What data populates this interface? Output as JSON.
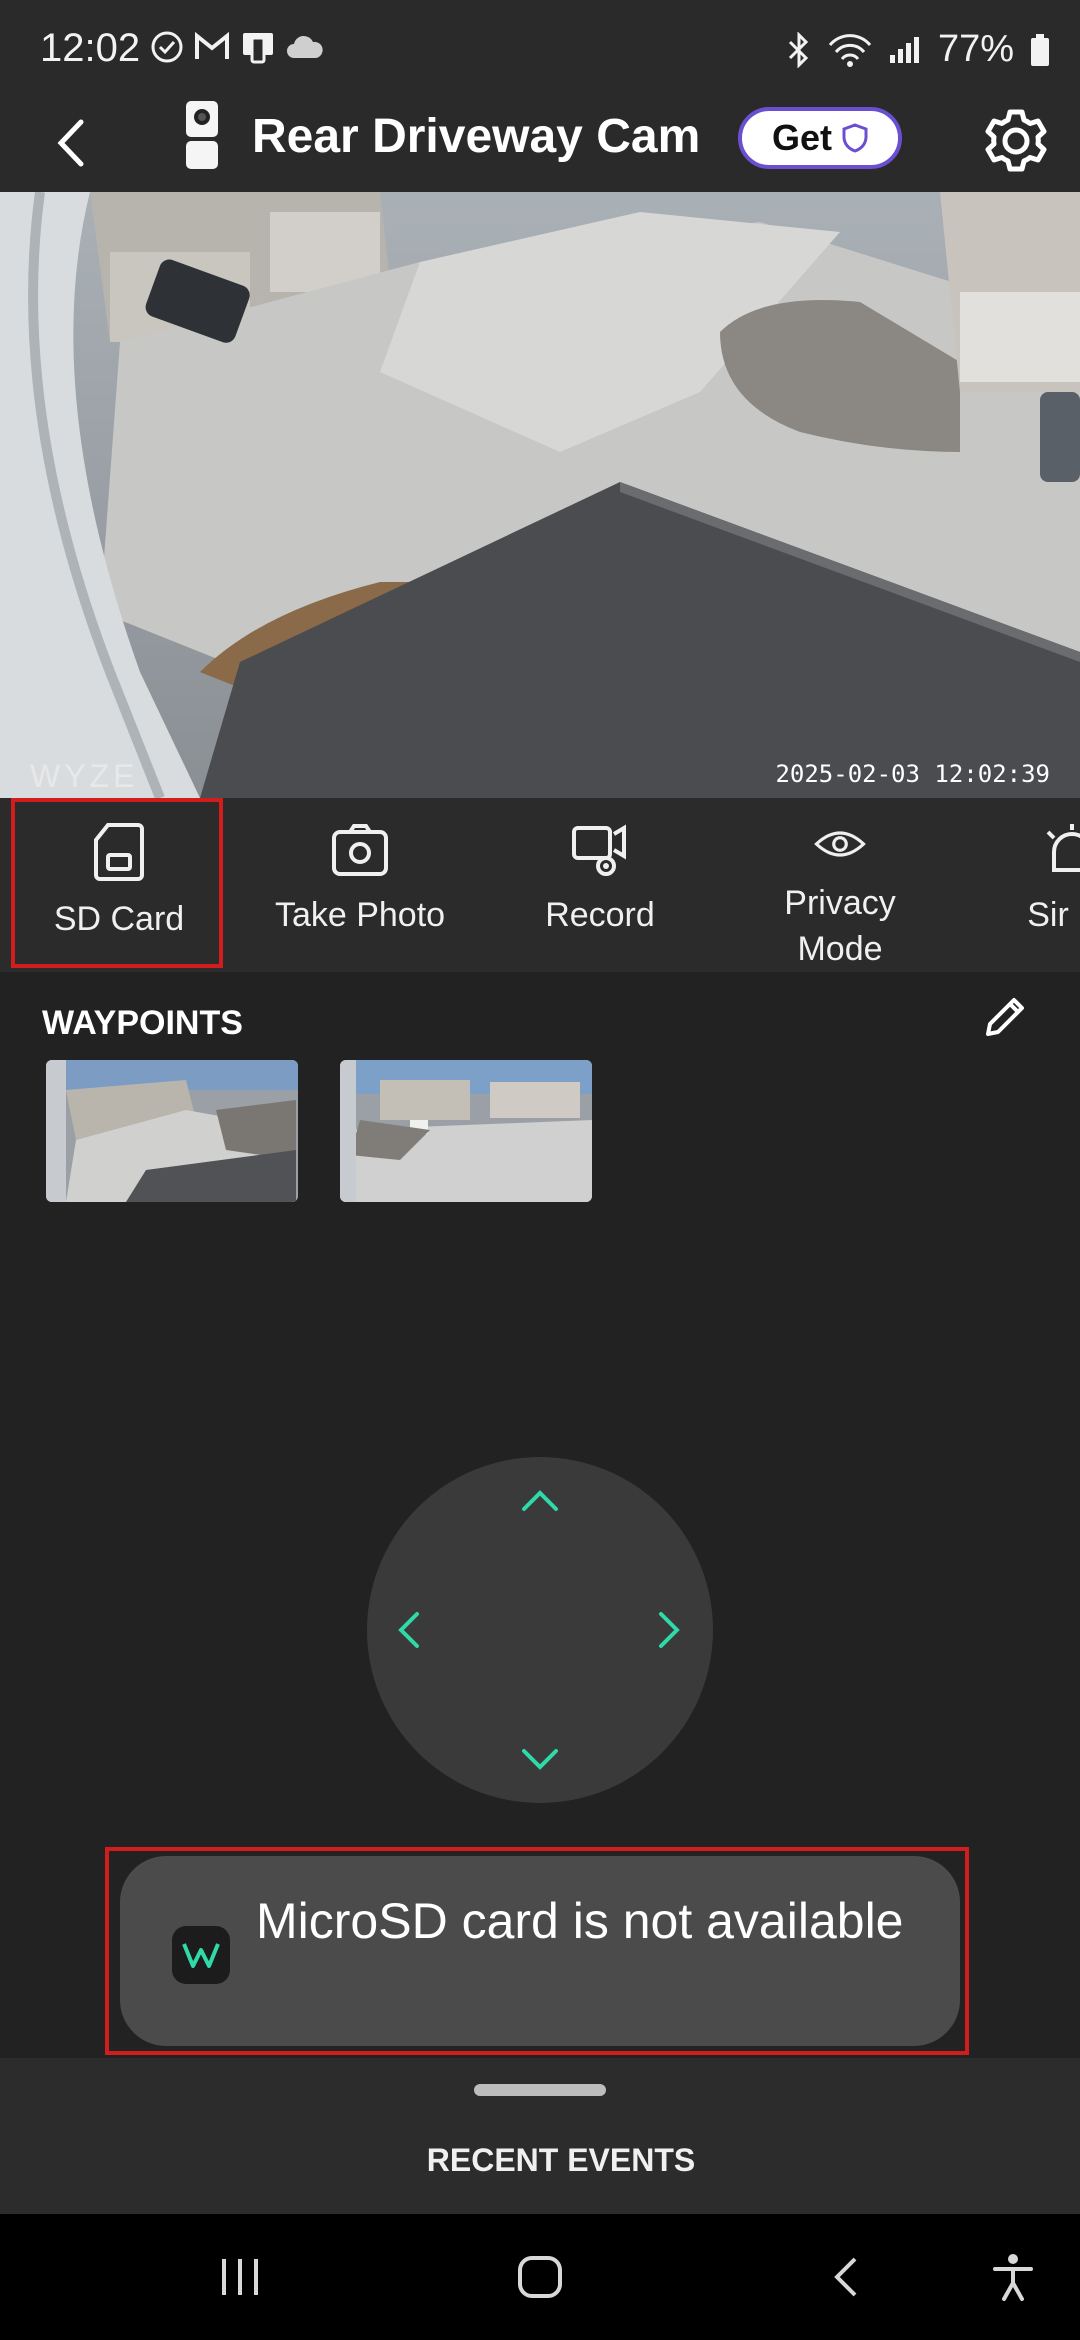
{
  "status_bar": {
    "time": "12:02",
    "battery": "77%"
  },
  "header": {
    "title": "Rear Driveway Cam",
    "get_label": "Get"
  },
  "video": {
    "watermark": "WYZE",
    "timestamp": "2025-02-03 12:02:39"
  },
  "controls": [
    {
      "label": "SD Card"
    },
    {
      "label": "Take Photo"
    },
    {
      "label": "Record"
    },
    {
      "label": "Privacy Mode"
    },
    {
      "label": "Sir"
    }
  ],
  "waypoints": {
    "title": "WAYPOINTS"
  },
  "toast": {
    "message": "MicroSD card is not available"
  },
  "recent_events": {
    "label": "RECENT EVENTS"
  },
  "colors": {
    "accent": "#2fd9a8",
    "highlight": "#d11d1d",
    "background": "#222222"
  }
}
